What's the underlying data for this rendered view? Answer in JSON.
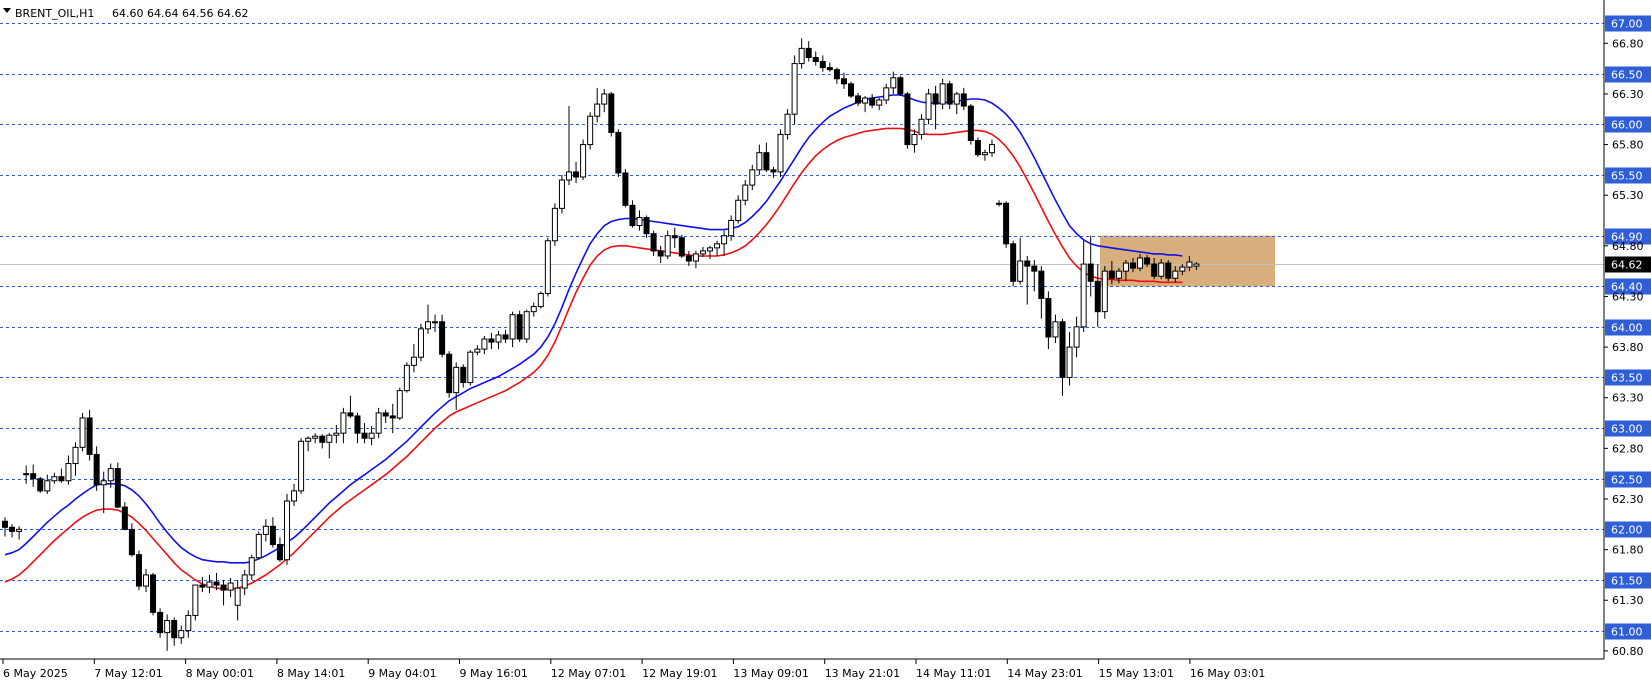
{
  "header": {
    "symbol": "BRENT_OIL,H1",
    "ohlc": "64.60 64.64 64.56 64.62"
  },
  "chart_data": {
    "type": "candlestick",
    "y_range": [
      60.7,
      67.05
    ],
    "price_axis_ticks": [
      "66.80",
      "66.30",
      "65.80",
      "65.30",
      "64.80",
      "64.30",
      "63.80",
      "63.30",
      "62.80",
      "62.30",
      "61.80",
      "61.30",
      "60.80"
    ],
    "levels": [
      {
        "price": 67.0,
        "label": "67.00"
      },
      {
        "price": 66.5,
        "label": "66.50"
      },
      {
        "price": 66.0,
        "label": "66.00"
      },
      {
        "price": 65.5,
        "label": "65.50"
      },
      {
        "price": 64.9,
        "label": "64.90"
      },
      {
        "price": 64.4,
        "label": "64.40"
      },
      {
        "price": 64.0,
        "label": "64.00"
      },
      {
        "price": 63.5,
        "label": "63.50"
      },
      {
        "price": 63.0,
        "label": "63.00"
      },
      {
        "price": 62.5,
        "label": "62.50"
      },
      {
        "price": 62.0,
        "label": "62.00"
      },
      {
        "price": 61.5,
        "label": "61.50"
      },
      {
        "price": 61.0,
        "label": "61.00"
      }
    ],
    "current_price": {
      "price": 64.62,
      "label": "64.62"
    },
    "time_labels": [
      "6 May 2025",
      "7 May 12:01",
      "8 May 00:01",
      "8 May 14:01",
      "9 May 04:01",
      "9 May 16:01",
      "12 May 07:01",
      "12 May 19:01",
      "13 May 09:01",
      "13 May 21:01",
      "14 May 11:01",
      "14 May 23:01",
      "15 May 13:01",
      "16 May 03:01"
    ],
    "zone": {
      "top": 64.9,
      "bottom": 64.4,
      "color": "#d7ae7c"
    },
    "colors": {
      "level": "#2f5ed6",
      "ma_fast": "#1010ee",
      "ma_slow": "#ee1010",
      "current_line": "#c0c0c0"
    },
    "candles": [
      [
        62.08,
        62.12,
        61.93,
        62.02
      ],
      [
        62.02,
        62.05,
        61.92,
        61.98
      ],
      [
        61.98,
        62.03,
        61.9,
        62.0
      ],
      [
        62.55,
        62.63,
        62.45,
        62.55
      ],
      [
        62.55,
        62.64,
        62.42,
        62.5
      ],
      [
        62.5,
        62.52,
        62.36,
        62.38
      ],
      [
        62.38,
        62.54,
        62.35,
        62.48
      ],
      [
        62.48,
        62.56,
        62.45,
        62.52
      ],
      [
        62.52,
        62.6,
        62.46,
        62.48
      ],
      [
        62.48,
        62.73,
        62.44,
        62.65
      ],
      [
        62.65,
        62.86,
        62.53,
        62.81
      ],
      [
        62.81,
        63.15,
        62.77,
        63.1
      ],
      [
        63.1,
        63.18,
        62.68,
        62.74
      ],
      [
        62.74,
        62.82,
        62.38,
        62.44
      ],
      [
        62.44,
        62.57,
        62.16,
        62.48
      ],
      [
        62.48,
        62.65,
        62.41,
        62.6
      ],
      [
        62.6,
        62.66,
        62.21,
        62.22
      ],
      [
        62.22,
        62.27,
        61.99,
        62.0
      ],
      [
        62.0,
        62.06,
        61.73,
        61.75
      ],
      [
        61.75,
        61.79,
        61.4,
        61.44
      ],
      [
        61.44,
        61.61,
        61.38,
        61.55
      ],
      [
        61.55,
        61.57,
        61.15,
        61.18
      ],
      [
        61.18,
        61.22,
        60.93,
        60.98
      ],
      [
        60.98,
        61.16,
        60.8,
        61.1
      ],
      [
        61.1,
        61.13,
        60.85,
        60.93
      ],
      [
        60.93,
        61.05,
        60.87,
        61.0
      ],
      [
        61.0,
        61.2,
        60.93,
        61.15
      ],
      [
        61.15,
        61.45,
        61.1,
        61.45
      ],
      [
        61.45,
        61.53,
        61.38,
        61.43
      ],
      [
        61.43,
        61.55,
        61.37,
        61.48
      ],
      [
        61.48,
        61.57,
        61.4,
        61.45
      ],
      [
        61.45,
        61.5,
        61.25,
        61.4
      ],
      [
        61.4,
        61.52,
        61.33,
        61.47
      ],
      [
        61.25,
        61.5,
        61.1,
        61.42
      ],
      [
        61.42,
        61.6,
        61.35,
        61.55
      ],
      [
        61.55,
        61.75,
        61.5,
        61.72
      ],
      [
        61.72,
        61.98,
        61.7,
        61.95
      ],
      [
        61.95,
        62.1,
        61.88,
        62.03
      ],
      [
        62.03,
        62.12,
        61.82,
        61.85
      ],
      [
        61.85,
        61.92,
        61.68,
        61.7
      ],
      [
        61.7,
        62.35,
        61.65,
        62.28
      ],
      [
        62.28,
        62.45,
        62.23,
        62.38
      ],
      [
        62.38,
        62.9,
        62.35,
        62.87
      ],
      [
        62.87,
        62.92,
        62.77,
        62.9
      ],
      [
        62.9,
        62.95,
        62.85,
        62.92
      ],
      [
        62.92,
        62.94,
        62.8,
        62.86
      ],
      [
        62.86,
        62.95,
        62.7,
        62.93
      ],
      [
        62.93,
        63.03,
        62.85,
        62.95
      ],
      [
        62.95,
        63.2,
        62.85,
        63.15
      ],
      [
        63.15,
        63.32,
        63.1,
        63.12
      ],
      [
        63.12,
        63.15,
        62.85,
        62.95
      ],
      [
        62.95,
        63.05,
        62.85,
        62.9
      ],
      [
        62.9,
        63.02,
        62.83,
        62.95
      ],
      [
        62.95,
        63.2,
        62.9,
        63.15
      ],
      [
        63.15,
        63.18,
        63.05,
        63.12
      ],
      [
        63.12,
        63.24,
        62.95,
        63.1
      ],
      [
        63.1,
        63.4,
        63.08,
        63.37
      ],
      [
        63.37,
        63.65,
        63.35,
        63.62
      ],
      [
        63.62,
        63.83,
        63.55,
        63.7
      ],
      [
        63.7,
        64.03,
        63.66,
        63.98
      ],
      [
        63.98,
        64.22,
        63.93,
        64.05
      ],
      [
        64.05,
        64.12,
        63.95,
        64.05
      ],
      [
        64.05,
        64.12,
        63.7,
        63.73
      ],
      [
        63.73,
        63.76,
        63.3,
        63.35
      ],
      [
        63.35,
        63.65,
        63.18,
        63.6
      ],
      [
        63.6,
        63.63,
        63.4,
        63.45
      ],
      [
        63.45,
        63.77,
        63.42,
        63.75
      ],
      [
        63.75,
        63.82,
        63.72,
        63.78
      ],
      [
        63.78,
        63.91,
        63.73,
        63.88
      ],
      [
        63.88,
        63.94,
        63.78,
        63.85
      ],
      [
        63.85,
        63.96,
        63.78,
        63.92
      ],
      [
        63.92,
        63.97,
        63.84,
        63.88
      ],
      [
        63.88,
        64.15,
        63.8,
        64.12
      ],
      [
        64.12,
        64.16,
        63.85,
        63.88
      ],
      [
        63.88,
        64.17,
        63.84,
        64.15
      ],
      [
        64.15,
        64.24,
        64.1,
        64.2
      ],
      [
        64.2,
        64.35,
        64.18,
        64.33
      ],
      [
        64.33,
        64.88,
        64.3,
        64.85
      ],
      [
        64.85,
        65.22,
        64.8,
        65.17
      ],
      [
        65.17,
        65.5,
        65.12,
        65.45
      ],
      [
        65.45,
        66.18,
        65.4,
        65.53
      ],
      [
        65.53,
        65.63,
        65.42,
        65.48
      ],
      [
        65.48,
        65.85,
        65.45,
        65.8
      ],
      [
        65.8,
        66.12,
        65.75,
        66.08
      ],
      [
        66.08,
        66.36,
        66.02,
        66.2
      ],
      [
        66.2,
        66.35,
        66.12,
        66.3
      ],
      [
        66.3,
        66.32,
        65.88,
        65.92
      ],
      [
        65.92,
        65.95,
        65.48,
        65.52
      ],
      [
        65.52,
        65.56,
        65.18,
        65.2
      ],
      [
        65.2,
        65.25,
        64.98,
        65.0
      ],
      [
        65.0,
        65.15,
        64.95,
        65.08
      ],
      [
        65.08,
        65.1,
        64.88,
        64.92
      ],
      [
        64.92,
        64.95,
        64.7,
        64.75
      ],
      [
        64.75,
        64.8,
        64.63,
        64.7
      ],
      [
        64.7,
        64.95,
        64.67,
        64.9
      ],
      [
        64.9,
        64.98,
        64.78,
        64.88
      ],
      [
        64.88,
        64.91,
        64.68,
        64.7
      ],
      [
        64.7,
        64.75,
        64.6,
        64.65
      ],
      [
        64.65,
        64.75,
        64.58,
        64.72
      ],
      [
        64.72,
        64.79,
        64.69,
        64.75
      ],
      [
        64.75,
        64.8,
        64.67,
        64.78
      ],
      [
        64.78,
        64.85,
        64.7,
        64.82
      ],
      [
        64.82,
        64.95,
        64.7,
        64.9
      ],
      [
        64.9,
        65.1,
        64.85,
        65.05
      ],
      [
        65.05,
        65.3,
        65.02,
        65.25
      ],
      [
        65.25,
        65.45,
        65.2,
        65.4
      ],
      [
        65.4,
        65.6,
        65.35,
        65.55
      ],
      [
        65.55,
        65.8,
        65.5,
        65.72
      ],
      [
        65.72,
        65.82,
        65.53,
        65.55
      ],
      [
        65.55,
        65.58,
        65.47,
        65.53
      ],
      [
        65.53,
        65.95,
        65.48,
        65.9
      ],
      [
        65.9,
        66.15,
        65.85,
        66.1
      ],
      [
        66.1,
        66.68,
        66.0,
        66.6
      ],
      [
        66.6,
        66.85,
        66.55,
        66.75
      ],
      [
        66.75,
        66.82,
        66.62,
        66.66
      ],
      [
        66.66,
        66.72,
        66.58,
        66.62
      ],
      [
        66.62,
        66.68,
        66.52,
        66.56
      ],
      [
        66.56,
        66.61,
        66.52,
        66.54
      ],
      [
        66.54,
        66.56,
        66.4,
        66.45
      ],
      [
        66.45,
        66.51,
        66.35,
        66.4
      ],
      [
        66.4,
        66.42,
        66.26,
        66.28
      ],
      [
        66.28,
        66.31,
        66.18,
        66.21
      ],
      [
        66.21,
        66.28,
        66.12,
        66.26
      ],
      [
        66.26,
        66.3,
        66.16,
        66.19
      ],
      [
        66.19,
        66.26,
        66.14,
        66.24
      ],
      [
        66.24,
        66.4,
        66.2,
        66.36
      ],
      [
        66.36,
        66.52,
        66.3,
        66.46
      ],
      [
        66.46,
        66.48,
        66.28,
        66.3
      ],
      [
        66.3,
        66.32,
        65.76,
        65.8
      ],
      [
        65.8,
        65.95,
        65.72,
        65.9
      ],
      [
        65.9,
        66.1,
        65.85,
        66.05
      ],
      [
        66.05,
        66.35,
        66.0,
        66.3
      ],
      [
        66.3,
        66.38,
        65.95,
        66.2
      ],
      [
        66.2,
        66.45,
        66.15,
        66.4
      ],
      [
        66.4,
        66.43,
        66.15,
        66.2
      ],
      [
        66.2,
        66.32,
        66.1,
        66.3
      ],
      [
        66.3,
        66.36,
        66.14,
        66.18
      ],
      [
        66.18,
        66.2,
        65.8,
        65.84
      ],
      [
        65.84,
        65.87,
        65.68,
        65.7
      ],
      [
        65.7,
        65.75,
        65.64,
        65.72
      ],
      [
        65.72,
        65.85,
        65.68,
        65.8
      ],
      [
        65.22,
        65.25,
        65.19,
        65.22
      ],
      [
        65.22,
        65.24,
        64.78,
        64.82
      ],
      [
        64.82,
        64.85,
        64.4,
        64.45
      ],
      [
        64.45,
        64.88,
        64.42,
        64.65
      ],
      [
        64.65,
        64.7,
        64.22,
        64.6
      ],
      [
        64.6,
        64.66,
        64.35,
        64.55
      ],
      [
        64.55,
        64.6,
        64.08,
        64.28
      ],
      [
        64.28,
        64.35,
        63.78,
        63.9
      ],
      [
        63.9,
        64.12,
        63.84,
        64.05
      ],
      [
        64.05,
        64.08,
        63.32,
        63.5
      ],
      [
        63.5,
        63.95,
        63.42,
        63.8
      ],
      [
        63.8,
        64.1,
        63.7,
        64.0
      ],
      [
        64.0,
        64.85,
        63.95,
        64.62
      ],
      [
        64.62,
        64.9,
        64.3,
        64.45
      ],
      [
        64.45,
        64.62,
        64.0,
        64.15
      ],
      [
        64.15,
        64.6,
        64.08,
        64.55
      ],
      [
        64.55,
        64.65,
        64.42,
        64.48
      ],
      [
        64.48,
        64.58,
        64.43,
        64.55
      ],
      [
        64.55,
        64.66,
        64.45,
        64.63
      ],
      [
        64.63,
        64.68,
        64.54,
        64.58
      ],
      [
        64.58,
        64.72,
        64.55,
        64.68
      ],
      [
        64.68,
        64.71,
        64.59,
        64.62
      ],
      [
        64.62,
        64.68,
        64.47,
        64.5
      ],
      [
        64.5,
        64.67,
        64.47,
        64.63
      ],
      [
        64.63,
        64.66,
        64.45,
        64.48
      ],
      [
        64.48,
        64.6,
        64.44,
        64.55
      ],
      [
        64.55,
        64.62,
        64.51,
        64.59
      ],
      [
        64.59,
        64.7,
        64.55,
        64.64
      ],
      [
        64.6,
        64.64,
        64.56,
        64.62
      ]
    ],
    "ma_fast": [
      61.75,
      61.77,
      61.8,
      61.86,
      61.93,
      62.0,
      62.07,
      62.13,
      62.19,
      62.24,
      62.3,
      62.35,
      62.4,
      62.44,
      62.45,
      62.45,
      62.45,
      62.43,
      62.39,
      62.33,
      62.25,
      62.16,
      62.06,
      61.97,
      61.89,
      61.82,
      61.77,
      61.73,
      61.7,
      61.69,
      61.68,
      61.68,
      61.67,
      61.67,
      61.67,
      61.68,
      61.71,
      61.74,
      61.78,
      61.82,
      61.87,
      61.92,
      61.98,
      62.05,
      62.12,
      62.19,
      62.26,
      62.32,
      62.38,
      62.44,
      62.49,
      62.54,
      62.59,
      62.64,
      62.69,
      62.75,
      62.81,
      62.87,
      62.94,
      63.01,
      63.08,
      63.15,
      63.21,
      63.27,
      63.31,
      63.35,
      63.39,
      63.42,
      63.45,
      63.48,
      63.51,
      63.55,
      63.59,
      63.63,
      63.68,
      63.73,
      63.8,
      63.9,
      64.03,
      64.19,
      64.37,
      64.53,
      64.68,
      64.82,
      64.92,
      65.0,
      65.04,
      65.06,
      65.07,
      65.07,
      65.06,
      65.05,
      65.04,
      65.03,
      65.02,
      65.01,
      65.0,
      64.99,
      64.98,
      64.97,
      64.96,
      64.96,
      64.96,
      64.97,
      64.99,
      65.03,
      65.09,
      65.16,
      65.24,
      65.34,
      65.44,
      65.55,
      65.66,
      65.77,
      65.87,
      65.95,
      66.02,
      66.08,
      66.12,
      66.16,
      66.19,
      66.22,
      66.24,
      66.26,
      66.27,
      66.28,
      66.29,
      66.29,
      66.27,
      66.24,
      66.22,
      66.21,
      66.21,
      66.21,
      66.22,
      66.23,
      66.24,
      66.25,
      66.25,
      66.24,
      66.21,
      66.16,
      66.1,
      66.02,
      65.92,
      65.8,
      65.67,
      65.53,
      65.39,
      65.25,
      65.12,
      65.0,
      64.92,
      64.86,
      64.82,
      64.8,
      64.79,
      64.78,
      64.77,
      64.76,
      64.75,
      64.74,
      64.73,
      64.72,
      64.72,
      64.71,
      64.71,
      64.7
    ],
    "ma_slow": [
      61.48,
      61.51,
      61.55,
      61.61,
      61.68,
      61.75,
      61.82,
      61.89,
      61.95,
      62.01,
      62.07,
      62.12,
      62.16,
      62.19,
      62.2,
      62.2,
      62.19,
      62.16,
      62.12,
      62.06,
      61.99,
      61.91,
      61.83,
      61.75,
      61.67,
      61.6,
      61.55,
      61.5,
      61.46,
      61.44,
      61.42,
      61.41,
      61.41,
      61.42,
      61.44,
      61.47,
      61.51,
      61.55,
      61.6,
      61.65,
      61.71,
      61.77,
      61.84,
      61.91,
      61.98,
      62.05,
      62.12,
      62.18,
      62.24,
      62.29,
      62.34,
      62.39,
      62.44,
      62.49,
      62.54,
      62.6,
      62.66,
      62.72,
      62.79,
      62.86,
      62.93,
      63.0,
      63.06,
      63.12,
      63.16,
      63.19,
      63.22,
      63.25,
      63.28,
      63.31,
      63.34,
      63.37,
      63.41,
      63.45,
      63.5,
      63.55,
      63.62,
      63.72,
      63.85,
      64.01,
      64.18,
      64.34,
      64.48,
      64.61,
      64.7,
      64.76,
      64.79,
      64.8,
      64.8,
      64.79,
      64.78,
      64.77,
      64.76,
      64.75,
      64.74,
      64.73,
      64.72,
      64.71,
      64.7,
      64.7,
      64.7,
      64.7,
      64.71,
      64.73,
      64.76,
      64.8,
      64.86,
      64.93,
      65.01,
      65.1,
      65.2,
      65.31,
      65.42,
      65.52,
      65.61,
      65.69,
      65.75,
      65.8,
      65.84,
      65.87,
      65.89,
      65.91,
      65.93,
      65.94,
      65.95,
      65.96,
      65.96,
      65.96,
      65.95,
      65.93,
      65.91,
      65.9,
      65.9,
      65.9,
      65.91,
      65.92,
      65.93,
      65.94,
      65.94,
      65.93,
      65.9,
      65.85,
      65.78,
      65.69,
      65.58,
      65.45,
      65.32,
      65.18,
      65.04,
      64.91,
      64.79,
      64.68,
      64.6,
      64.54,
      64.5,
      64.48,
      64.47,
      64.47,
      64.46,
      64.46,
      64.46,
      64.45,
      64.45,
      64.45,
      64.44,
      64.44,
      64.44,
      64.44
    ]
  }
}
